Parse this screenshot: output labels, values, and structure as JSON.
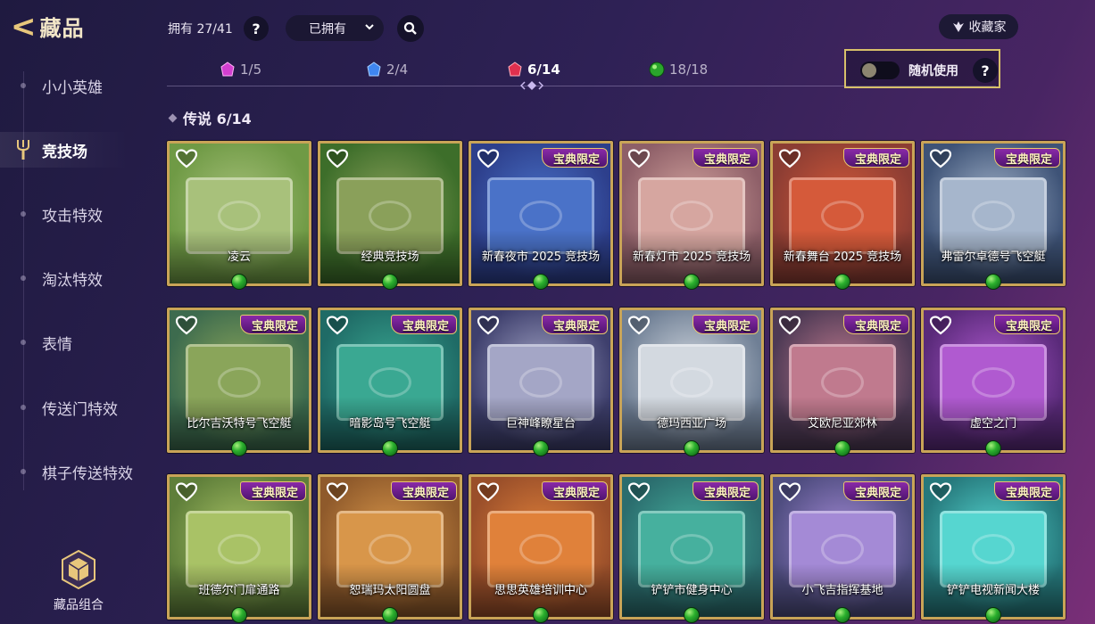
{
  "header": {
    "title": "藏品",
    "owned": "拥有 27/41",
    "help": "?",
    "filter": "已拥有",
    "collector": "收藏家"
  },
  "sidebar": {
    "items": [
      {
        "label": "小小英雄",
        "active": false
      },
      {
        "label": "竞技场",
        "active": true
      },
      {
        "label": "攻击特效",
        "active": false
      },
      {
        "label": "淘汰特效",
        "active": false
      },
      {
        "label": "表情",
        "active": false
      },
      {
        "label": "传送门特效",
        "active": false
      },
      {
        "label": "棋子传送特效",
        "active": false
      }
    ],
    "combo_label": "藏品组合"
  },
  "tabs": [
    {
      "count": "1/5",
      "color": "#d33fd0"
    },
    {
      "count": "2/4",
      "color": "#3f86f0"
    },
    {
      "count": "6/14",
      "color": "#e0304e"
    },
    {
      "count": "18/18",
      "color": "#2aa52c"
    }
  ],
  "random": {
    "label": "随机使用",
    "help": "?",
    "enabled": false
  },
  "section": {
    "title": "传说 6/14"
  },
  "badge_label": "宝典限定",
  "cards": [
    {
      "name": "凌云",
      "badge": false,
      "bg": "#6f9a45",
      "board": "#a8c17b"
    },
    {
      "name": "经典竞技场",
      "badge": false,
      "bg": "#3d6e2a",
      "board": "#8aa05a"
    },
    {
      "name": "新春夜市  2025  竞技场",
      "badge": true,
      "bg": "#2d3f8c",
      "board": "#4a72c8"
    },
    {
      "name": "新春灯市  2025  竞技场",
      "badge": true,
      "bg": "#8e5f68",
      "board": "#d6a6a0"
    },
    {
      "name": "新春舞台  2025  竞技场",
      "badge": true,
      "bg": "#8c3d33",
      "board": "#d55a3a"
    },
    {
      "name": "弗雷尔卓德号飞空艇",
      "badge": true,
      "bg": "#3e5377",
      "board": "#a6b6cc"
    },
    {
      "name": "比尔吉沃特号飞空艇",
      "badge": true,
      "bg": "#3d6b4e",
      "board": "#8aa55a"
    },
    {
      "name": "暗影岛号飞空艇",
      "badge": true,
      "bg": "#1f6b66",
      "board": "#3aa892"
    },
    {
      "name": "巨神峰瞭星台",
      "badge": true,
      "bg": "#3e3f6d",
      "board": "#a4a6c6"
    },
    {
      "name": "德玛西亚广场",
      "badge": true,
      "bg": "#6f7f95",
      "board": "#d3d9e0"
    },
    {
      "name": "艾欧尼亚郊林",
      "badge": true,
      "bg": "#4e3a55",
      "board": "#c07a8e"
    },
    {
      "name": "虚空之门",
      "badge": true,
      "bg": "#5a2a7a",
      "board": "#b05ad0"
    },
    {
      "name": "班德尔门扉通路",
      "badge": true,
      "bg": "#5f7f3a",
      "board": "#a9c266"
    },
    {
      "name": "恕瑞玛太阳圆盘",
      "badge": true,
      "bg": "#8f5a2b",
      "board": "#d8964a"
    },
    {
      "name": "思思英雄培训中心",
      "badge": true,
      "bg": "#9a4f2a",
      "board": "#e0813a"
    },
    {
      "name": "铲铲市健身中心",
      "badge": true,
      "bg": "#2b6d6e",
      "board": "#46b09e"
    },
    {
      "name": "小飞吉指挥基地",
      "badge": true,
      "bg": "#4f4d80",
      "board": "#a48ad6"
    },
    {
      "name": "铲铲电视新闻大楼",
      "badge": true,
      "bg": "#26797c",
      "board": "#56d6d0"
    }
  ]
}
